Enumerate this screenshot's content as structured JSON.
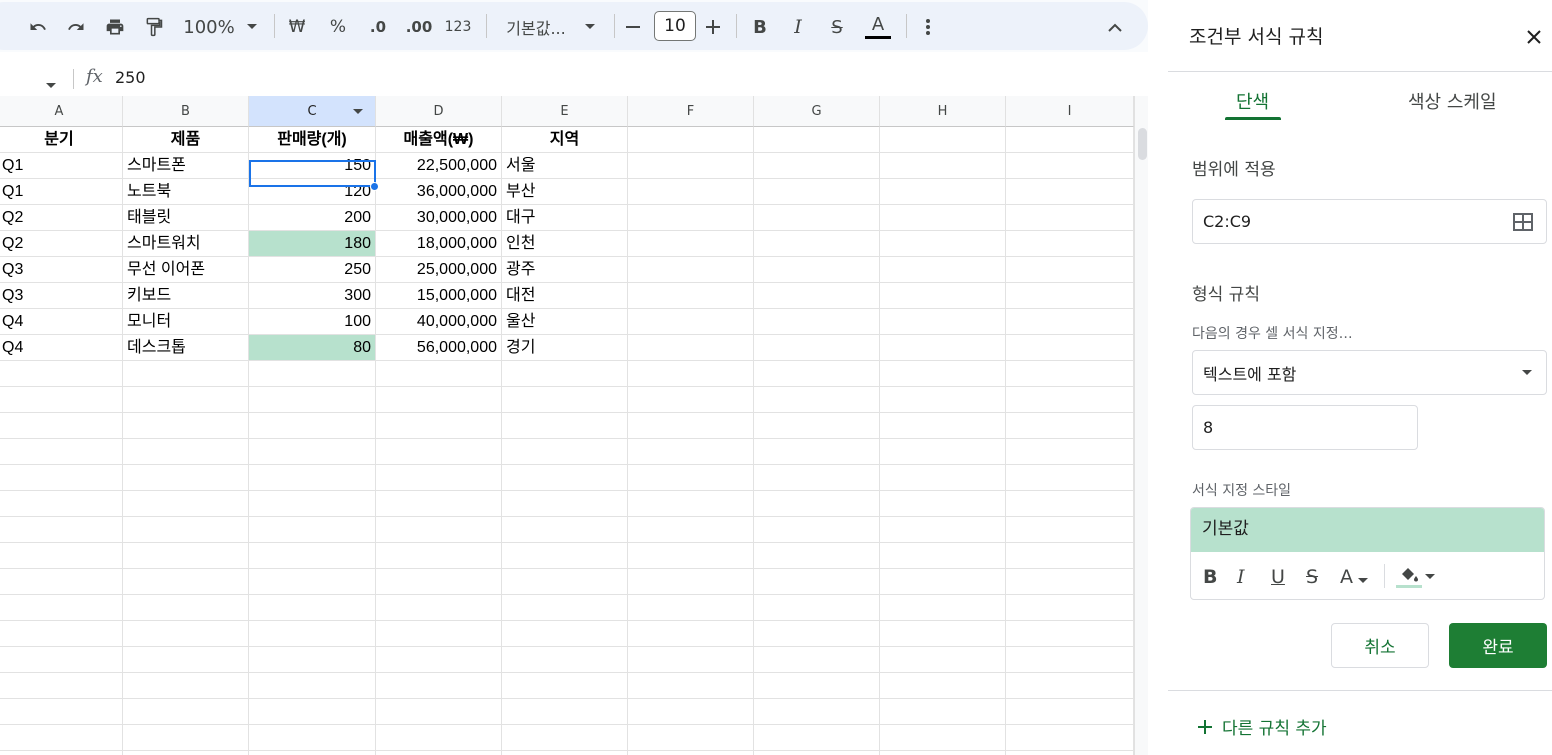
{
  "toolbar": {
    "zoom": "100%",
    "currency": "₩",
    "percent": "%",
    "decrease_decimal": ".0",
    "increase_decimal": ".00",
    "number_format": "123",
    "font_name": "기본값...",
    "font_size": "10",
    "bold": "B",
    "italic": "I",
    "strikethrough": "S",
    "text_color": "A"
  },
  "formula_bar": {
    "fx_label": "fx",
    "value": "250"
  },
  "columns": [
    "A",
    "B",
    "C",
    "D",
    "E",
    "F",
    "G",
    "H",
    "I"
  ],
  "rows": [
    [
      "분기",
      "제품",
      "판매량(개)",
      "매출액(₩)",
      "지역"
    ],
    [
      "Q1",
      "스마트폰",
      "150",
      "22,500,000",
      "서울"
    ],
    [
      "Q1",
      "노트북",
      "120",
      "36,000,000",
      "부산"
    ],
    [
      "Q2",
      "태블릿",
      "200",
      "30,000,000",
      "대구"
    ],
    [
      "Q2",
      "스마트워치",
      "180",
      "18,000,000",
      "인천"
    ],
    [
      "Q3",
      "무선 이어폰",
      "250",
      "25,000,000",
      "광주"
    ],
    [
      "Q3",
      "키보드",
      "300",
      "15,000,000",
      "대전"
    ],
    [
      "Q4",
      "모니터",
      "100",
      "40,000,000",
      "울산"
    ],
    [
      "Q4",
      "데스크톱",
      "80",
      "56,000,000",
      "경기"
    ]
  ],
  "highlight_color": "#b7e1cd",
  "accent_color": "#137333",
  "panel": {
    "title": "조건부 서식 규칙",
    "tabs": [
      "단색",
      "색상 스케일"
    ],
    "range_label": "범위에 적용",
    "range_value": "C2:C9",
    "format_rules_label": "형식 규칙",
    "condition_label": "다음의 경우 셀 서식 지정…",
    "condition_value": "텍스트에 포함",
    "condition_input": "8",
    "style_label": "서식 지정 스타일",
    "style_preview": "기본값",
    "style_tools": [
      "B",
      "I",
      "U",
      "S",
      "A"
    ],
    "cancel_label": "취소",
    "done_label": "완료",
    "add_rule_label": "다른 규칙 추가"
  }
}
